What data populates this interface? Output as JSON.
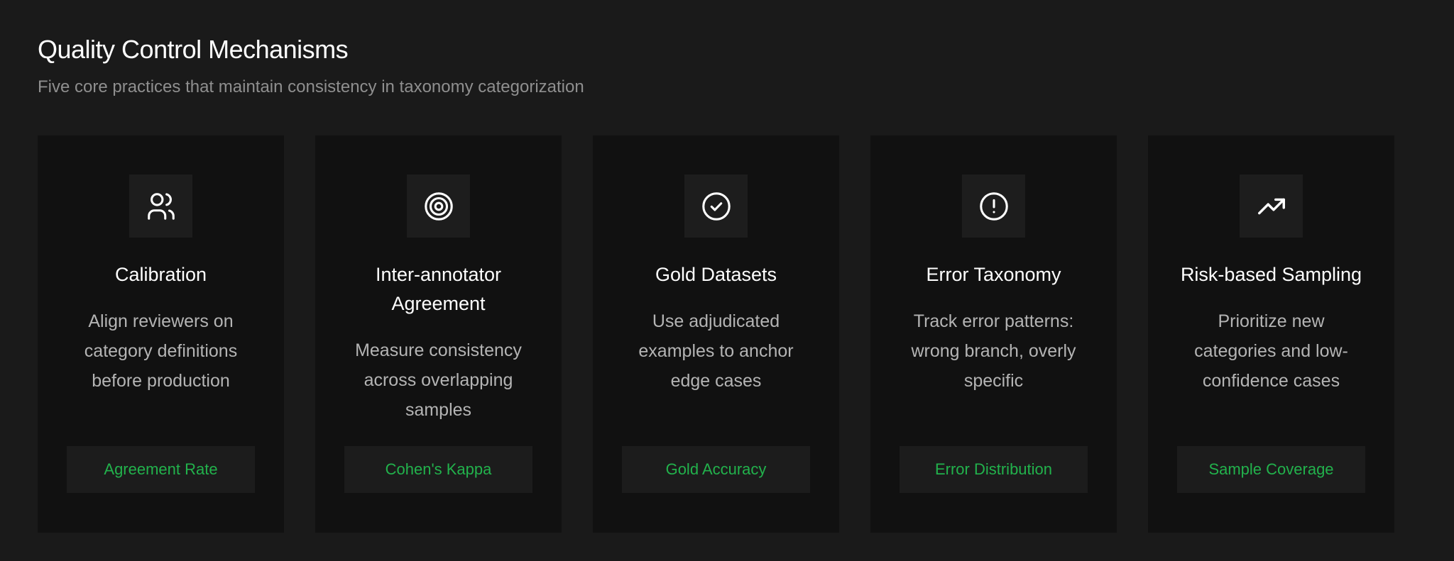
{
  "header": {
    "title": "Quality Control Mechanisms",
    "subtitle": "Five core practices that maintain consistency in taxonomy categorization"
  },
  "colors": {
    "background": "#1a1a1a",
    "card": "#111111",
    "accent": "#22b24c"
  },
  "cards": [
    {
      "icon": "users-icon",
      "title": "Calibration",
      "description": "Align reviewers on category definitions before production",
      "metric": "Agreement Rate"
    },
    {
      "icon": "target-icon",
      "title": "Inter-annotator Agreement",
      "description": "Measure consistency across overlapping samples",
      "metric": "Cohen's Kappa"
    },
    {
      "icon": "check-circle-icon",
      "title": "Gold Datasets",
      "description": "Use adjudicated examples to anchor edge cases",
      "metric": "Gold Accuracy"
    },
    {
      "icon": "alert-circle-icon",
      "title": "Error Taxonomy",
      "description": "Track error patterns: wrong branch, overly specific",
      "metric": "Error Distribution"
    },
    {
      "icon": "trending-up-icon",
      "title": "Risk-based Sampling",
      "description": "Prioritize new categories and low-confidence cases",
      "metric": "Sample Coverage"
    }
  ]
}
